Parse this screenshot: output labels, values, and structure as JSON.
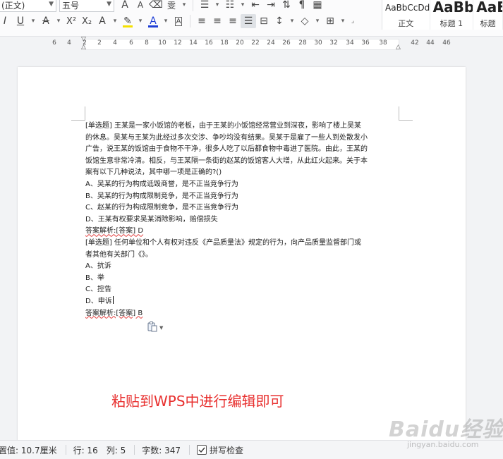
{
  "toolbar": {
    "style_combo": "(正文)",
    "size_combo": "五号",
    "font_color": "#1f3fd6",
    "styles": [
      {
        "sample": "AaBbCcDd",
        "name": "正文"
      },
      {
        "sample": "AaBb",
        "name": "标题 1"
      },
      {
        "sample": "AaE",
        "name": "标题"
      }
    ]
  },
  "ruler": {
    "numbers": [
      "6",
      "4",
      "2",
      "2",
      "4",
      "6",
      "8",
      "10",
      "12",
      "14",
      "16",
      "18",
      "20",
      "22",
      "24",
      "26",
      "28",
      "30",
      "32",
      "34",
      "36",
      "38",
      "42",
      "44",
      "46"
    ]
  },
  "document": {
    "lines": [
      "[单选题] 王某是一家小饭馆的老板，由于王某的小饭馆经常营业到深夜，影响了楼上吴某",
      "的休息。吴某与王某为此经过多次交涉、争吵均没有结果。吴某于是雇了一些人到处散发小",
      "广告，说王某的饭馆由于食物不干净，很多人吃了以后都食物中毒进了医院。由此，王某的",
      "饭馆生意非常冷清。相反，与王某隔一条街的赵某的饭馆客人大增，从此红火起来。关于本",
      "案有以下几种说法，其中哪一项是正确的?()",
      "A、吴某的行为构成诋毁商誉，是不正当竞争行为",
      "B、吴某的行为构成限制竞争，是不正当竞争行为",
      "C、赵某的行为构成限制竞争，是不正当竞争行为",
      "D、王某有权要求吴某消除影响，赔偿损失",
      "答案解析:[答案] D",
      "[单选题] 任何单位和个人有权对违反《产品质量法》规定的行为，向产品质量监督部门或",
      "者其他有关部门《》。",
      "A、抗诉",
      "B、举",
      "C、控告",
      "D、申诉",
      "答案解析:[答案] B"
    ],
    "caption": "粘贴到WPS中进行编辑即可"
  },
  "status": {
    "position": "置值: 10.7厘米",
    "line": "行: 16",
    "column": "列: 5",
    "word_count": "字数: 347",
    "spellcheck": "拼写检查"
  },
  "watermark": {
    "text": "Baidu经验",
    "sub": "jingyan.baidu.com"
  }
}
